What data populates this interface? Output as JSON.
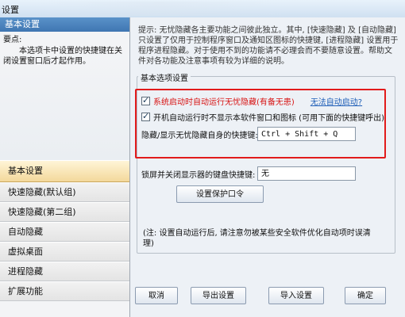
{
  "window": {
    "title": "设置"
  },
  "left_panel": {
    "header": "基本设置",
    "tips_title": "要点:",
    "tips_body": "本选项卡中设置的快捷键在关闭设置窗口后才起作用。",
    "items": [
      {
        "label": "基本设置",
        "active": true
      },
      {
        "label": "快速隐藏(默认组)",
        "active": false
      },
      {
        "label": "快速隐藏(第二组)",
        "active": false
      },
      {
        "label": "自动隐藏",
        "active": false
      },
      {
        "label": "虚拟桌面",
        "active": false
      },
      {
        "label": "进程隐藏",
        "active": false
      },
      {
        "label": "扩展功能",
        "active": false
      }
    ]
  },
  "main": {
    "hint": "提示: 无忧隐藏各主要功能之间彼此独立。其中, [快速隐藏] 及 [自动隐藏] 只设置了仅用于控制程序窗口及通知区图标的快捷键, [进程隐藏] 设置用于程序进程隐藏。对于使用不到的功能请不必理会而不要随意设置。帮助文件对各功能及注意事项有较为详细的说明。",
    "group_title": "基本选项设置",
    "option1": {
      "label_prefix": "系统启动时自动运行无忧隐藏",
      "label_suffix": "(有备无患)",
      "link": "无法自动启动?"
    },
    "option2": {
      "label": "开机自动运行时不显示本软件窗口和图标 (可用下面的快捷键呼出)"
    },
    "hotkey": {
      "label": "隐藏/显示无忧隐藏自身的快捷键:",
      "value": "Ctrl + Shift + Q"
    },
    "lock": {
      "label": "锁屏并关闭显示器的键盘快捷键:",
      "value": "无"
    },
    "protect_button": "设置保护口令",
    "note": "(注: 设置自动运行后, 请注意勿被某些安全软件优化自动项时误清理)"
  },
  "buttons": {
    "cancel": "取消",
    "export": "导出设置",
    "import": "导入设置",
    "ok": "确定"
  }
}
